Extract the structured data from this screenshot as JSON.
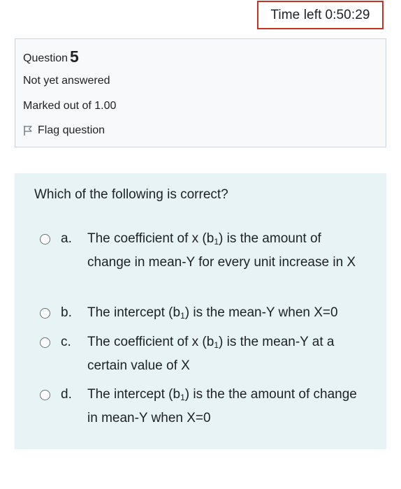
{
  "timer": {
    "label": "Time left",
    "value": "0:50:29"
  },
  "question_info": {
    "label": "Question",
    "number": "5",
    "state": "Not yet answered",
    "grade": "Marked out of 1.00",
    "flag_label": "Flag question",
    "flag_icon": "flag-icon"
  },
  "question": {
    "text": "Which of the following is correct?",
    "options": [
      {
        "letter": "a.",
        "before": "The coefficient of x (b",
        "sub": "1",
        "after": ") is the amount of change in mean-Y for every unit increase in X"
      },
      {
        "letter": "b.",
        "before": "The intercept (b",
        "sub": "1",
        "after": ") is the mean-Y when X=0"
      },
      {
        "letter": "c.",
        "before": "The coefficient of x (b",
        "sub": "1",
        "after": ") is the mean-Y at a certain value of X"
      },
      {
        "letter": "d.",
        "before": "The intercept (b",
        "sub": "1",
        "after": ") is the the amount of change in mean-Y when X=0"
      }
    ]
  },
  "colors": {
    "timer_border": "#ca3120",
    "info_background": "#f8f9fa",
    "content_background": "#e7f3f5"
  }
}
